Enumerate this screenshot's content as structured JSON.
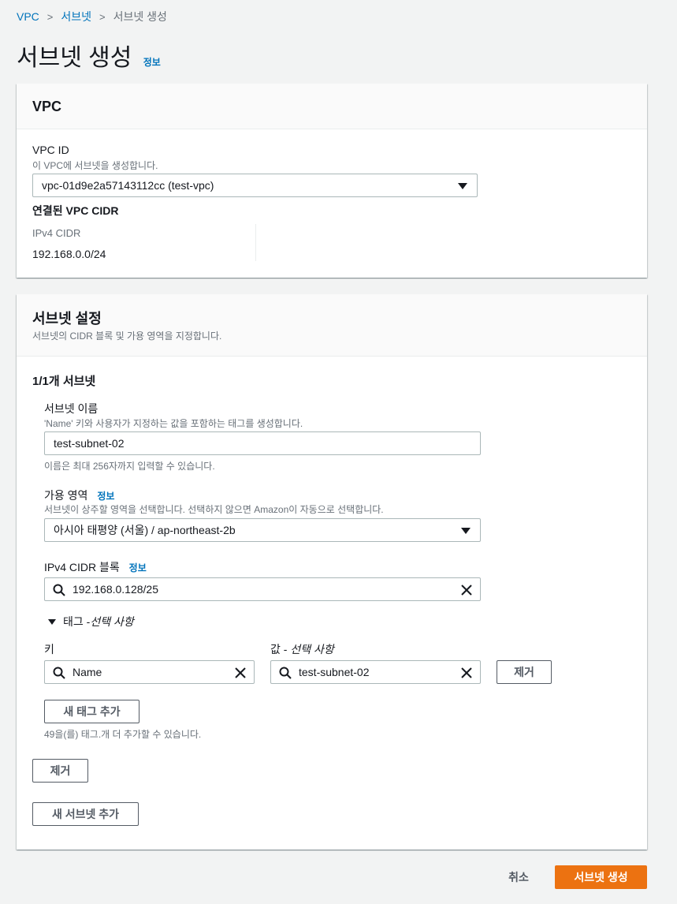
{
  "breadcrumb": {
    "items": [
      "VPC",
      "서브넷"
    ],
    "current": "서브넷 생성"
  },
  "page": {
    "title": "서브넷 생성",
    "info": "정보"
  },
  "vpc_panel": {
    "title": "VPC",
    "vpc_id_label": "VPC ID",
    "vpc_id_desc": "이 VPC에 서브넷을 생성합니다.",
    "vpc_id_value": "vpc-01d9e2a57143112cc (test-vpc)",
    "cidr_heading": "연결된 VPC CIDR",
    "ipv4_label": "IPv4 CIDR",
    "ipv4_value": "192.168.0.0/24"
  },
  "subnet_panel": {
    "title": "서브넷 설정",
    "desc": "서브넷의 CIDR 블록 및 가용 영역을 지정합니다.",
    "count_label": "1/1개 서브넷",
    "name_label": "서브넷 이름",
    "name_desc": "'Name' 키와 사용자가 지정하는 값을 포함하는 태그를 생성합니다.",
    "name_value": "test-subnet-02",
    "name_hint": "이름은 최대 256자까지 입력할 수 있습니다.",
    "az_label": "가용 영역",
    "az_info": "정보",
    "az_desc": "서브넷이 상주할 영역을 선택합니다. 선택하지 않으면 Amazon이 자동으로 선택합니다.",
    "az_value": "아시아 태평양 (서울) / ap-northeast-2b",
    "cidr_label": "IPv4 CIDR 블록",
    "cidr_info": "정보",
    "cidr_value": "192.168.0.128/25",
    "tags_toggle_prefix": "태그 - ",
    "tags_toggle_optional": "선택 사항",
    "key_label": "키",
    "value_label_prefix": "값 - ",
    "value_label_optional": "선택 사항",
    "key_value": "Name",
    "tag_value": "test-subnet-02",
    "remove_tag_label": "제거",
    "add_tag_label": "새 태그 추가",
    "tag_limit_hint": "49을(를) 태그.개 더 추가할 수 있습니다.",
    "remove_subnet_label": "제거",
    "add_subnet_label": "새 서브넷 추가"
  },
  "footer": {
    "cancel_label": "취소",
    "create_label": "서브넷 생성"
  },
  "colors": {
    "accent": "#ec7211",
    "link": "#0073bb",
    "border": "#aab7b8"
  }
}
